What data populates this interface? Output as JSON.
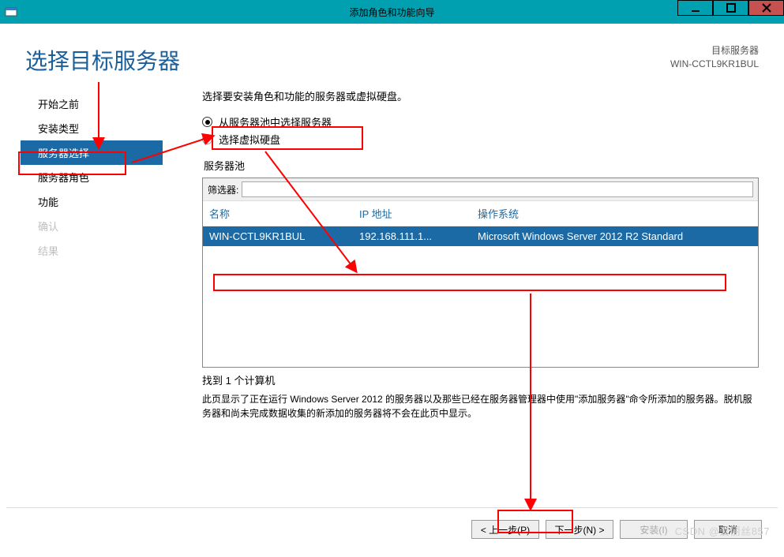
{
  "titlebar": {
    "title": "添加角色和功能向导"
  },
  "header": {
    "heading": "选择目标服务器",
    "dest_label": "目标服务器",
    "dest_value": "WIN-CCTL9KR1BUL"
  },
  "nav": {
    "items": [
      {
        "label": "开始之前",
        "state": "normal"
      },
      {
        "label": "安装类型",
        "state": "normal"
      },
      {
        "label": "服务器选择",
        "state": "active"
      },
      {
        "label": "服务器角色",
        "state": "normal"
      },
      {
        "label": "功能",
        "state": "normal"
      },
      {
        "label": "确认",
        "state": "disabled"
      },
      {
        "label": "结果",
        "state": "disabled"
      }
    ]
  },
  "main": {
    "instruction": "选择要安装角色和功能的服务器或虚拟硬盘。",
    "radios": {
      "pool_label": "从服务器池中选择服务器",
      "vhd_label": "选择虚拟硬盘"
    },
    "pool_section_label": "服务器池",
    "filter_label": "筛选器:",
    "filter_value": "",
    "columns": {
      "name": "名称",
      "ip": "IP 地址",
      "os": "操作系统"
    },
    "rows": [
      {
        "name": "WIN-CCTL9KR1BUL",
        "ip": "192.168.111.1...",
        "os": "Microsoft Windows Server 2012 R2 Standard"
      }
    ],
    "found_text": "找到 1 个计算机",
    "notes_text": "此页显示了正在运行 Windows Server 2012 的服务器以及那些已经在服务器管理器中使用\"添加服务器\"命令所添加的服务器。脱机服务器和尚未完成数据收集的新添加的服务器将不会在此页中显示。"
  },
  "footer": {
    "prev": "< 上一步(P)",
    "next": "下一步(N) >",
    "install": "安装(I)",
    "cancel": "取消"
  },
  "watermark": "CSDN @爱丽丝857"
}
